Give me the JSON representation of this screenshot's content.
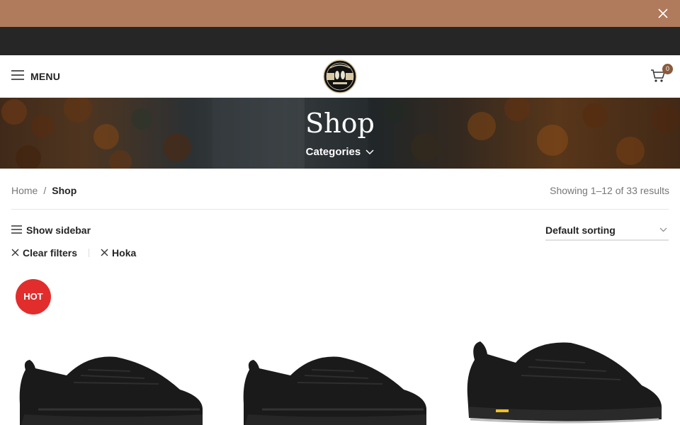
{
  "header": {
    "menu_label": "MENU",
    "cart_count": "0",
    "logo_alt": "SHOP DIRECT UK"
  },
  "hero": {
    "title": "Shop",
    "categories_label": "Categories"
  },
  "breadcrumb": {
    "home": "Home",
    "separator": "/",
    "current": "Shop"
  },
  "results": {
    "showing": "Showing 1–12 of 33 results"
  },
  "toolbar": {
    "show_sidebar": "Show sidebar",
    "sorting": "Default sorting"
  },
  "filters": {
    "clear": "Clear filters",
    "active": [
      "Hoka"
    ]
  },
  "products": [
    {
      "badge": "HOT",
      "image": "black-hoka-trail-shoe"
    },
    {
      "badge": "",
      "image": "black-hoka-trail-shoe"
    },
    {
      "badge": "",
      "image": "black-hoka-hiking-shoe-vibram"
    }
  ],
  "colors": {
    "promo_bar": "#b07a5c",
    "top_bar": "#262626",
    "hot_badge": "#e22d2d",
    "cart_count": "#8a5a3c"
  },
  "icons": {
    "promo_close": "close-icon",
    "menu": "hamburger-icon",
    "cart": "cart-icon",
    "categories": "chevron-down-icon",
    "sidebar": "hamburger-icon",
    "clear": "close-icon",
    "sort": "chevron-down-icon"
  }
}
